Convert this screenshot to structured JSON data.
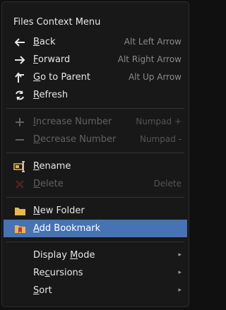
{
  "menu": {
    "title": "Files Context Menu",
    "items": {
      "back": {
        "pre": "",
        "u": "B",
        "post": "ack",
        "shortcut": "Alt Left Arrow",
        "icon": "arrow-left-icon"
      },
      "forward": {
        "pre": "",
        "u": "F",
        "post": "orward",
        "shortcut": "Alt Right Arrow",
        "icon": "arrow-right-icon"
      },
      "parent": {
        "pre": "",
        "u": "G",
        "post": "o to Parent",
        "shortcut": "Alt Up Arrow",
        "icon": "parent-dir-icon"
      },
      "refresh": {
        "pre": "",
        "u": "R",
        "post": "efresh",
        "shortcut": "",
        "icon": "refresh-icon"
      },
      "increase": {
        "pre": "",
        "u": "I",
        "post": "ncrease Number",
        "shortcut": "Numpad +",
        "icon": "plus-icon"
      },
      "decrease": {
        "pre": "",
        "u": "D",
        "post": "ecrease Number",
        "shortcut": "Numpad -",
        "icon": "minus-icon"
      },
      "rename": {
        "pre": "",
        "u": "R",
        "post": "ename",
        "shortcut": "",
        "icon": "rename-icon"
      },
      "delete": {
        "pre": "",
        "u": "D",
        "post": "elete",
        "shortcut": "Delete",
        "icon": "delete-x-icon"
      },
      "new_folder": {
        "pre": "",
        "u": "N",
        "post": "ew Folder",
        "shortcut": "",
        "icon": "folder-icon"
      },
      "add_bookmark": {
        "pre": "",
        "u": "A",
        "post": "dd Bookmark",
        "shortcut": "",
        "icon": "bookmark-folder-icon"
      },
      "display_mode": {
        "pre": "Display ",
        "u": "M",
        "post": "ode",
        "shortcut": "",
        "icon": ""
      },
      "recursions": {
        "pre": "Re",
        "u": "c",
        "post": "ursions",
        "shortcut": "",
        "icon": ""
      },
      "sort": {
        "pre": "",
        "u": "S",
        "post": "ort",
        "shortcut": "",
        "icon": ""
      }
    },
    "submenu_arrow": "▸",
    "colors": {
      "highlight": "#4772b3",
      "delete_x": "#c8323c",
      "folder": "#e8b84a"
    }
  }
}
